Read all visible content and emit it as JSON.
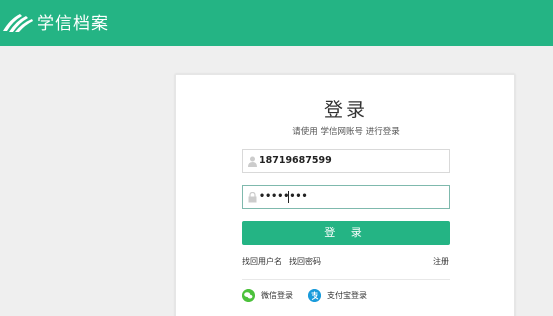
{
  "header": {
    "brand": "学信档案",
    "bg_color": "#24b484"
  },
  "login": {
    "title": "登录",
    "subtitle": "请使用 学信网账号 进行登录",
    "username_value": "18719687599",
    "password_value": "••••••••",
    "submit_label": "登 录",
    "find_username": "找回用户名",
    "find_password": "找回密码",
    "register": "注册",
    "wechat_login": "微信登录",
    "alipay_login": "支付宝登录",
    "accent_color": "#24b484"
  }
}
